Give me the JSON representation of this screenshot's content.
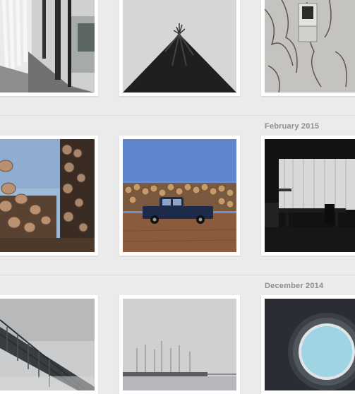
{
  "sections": [
    {
      "month_label": ""
    },
    {
      "month_label": "February 2015"
    },
    {
      "month_label": "December 2014"
    }
  ],
  "photos": [
    {
      "subject": "glass-corridor-curtains-photo"
    },
    {
      "subject": "dead-tree-looking-up-photo"
    },
    {
      "subject": "vine-covered-wall-photo"
    },
    {
      "subject": "log-stacks-sky-photo"
    },
    {
      "subject": "pickup-truck-log-yard-photo"
    },
    {
      "subject": "dark-dining-room-photo"
    },
    {
      "subject": "bridge-in-fog-photo"
    },
    {
      "subject": "foggy-harbor-sailboats-photo"
    },
    {
      "subject": "circular-skylight-photo"
    }
  ],
  "colors": {
    "background": "#ebebeb",
    "tile": "#ffffff",
    "label": "#8d8d8d",
    "divider": "#dedede"
  }
}
